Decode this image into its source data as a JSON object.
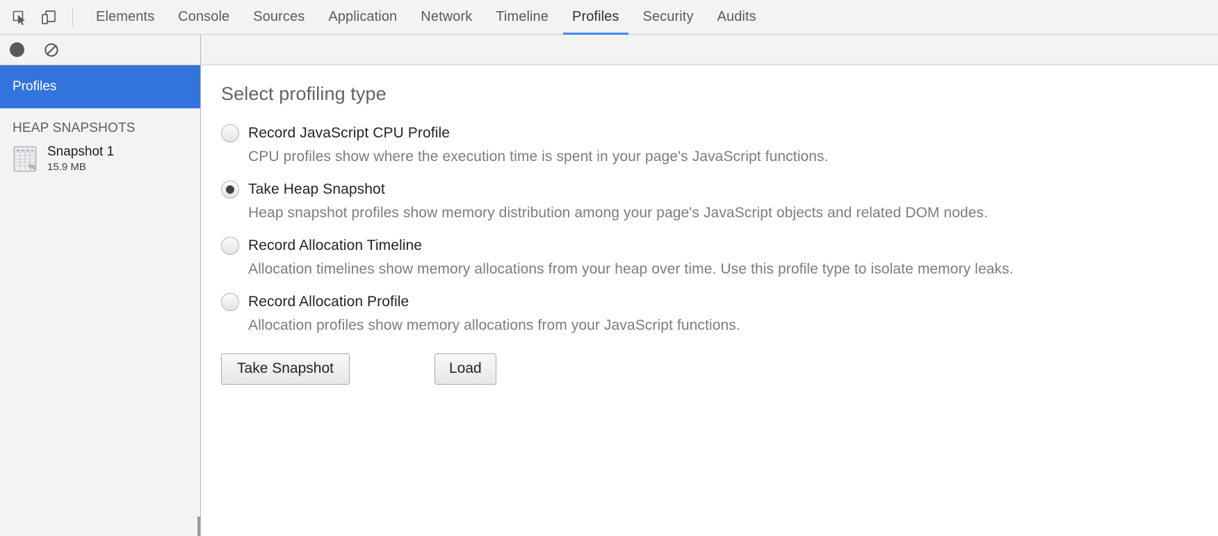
{
  "toolbar": {
    "inspect_icon": "inspect-element-icon",
    "device_icon": "device-toolbar-icon",
    "tabs": [
      {
        "label": "Elements",
        "active": false
      },
      {
        "label": "Console",
        "active": false
      },
      {
        "label": "Sources",
        "active": false
      },
      {
        "label": "Application",
        "active": false
      },
      {
        "label": "Network",
        "active": false
      },
      {
        "label": "Timeline",
        "active": false
      },
      {
        "label": "Profiles",
        "active": true
      },
      {
        "label": "Security",
        "active": false
      },
      {
        "label": "Audits",
        "active": false
      }
    ],
    "active_tab_accent": "#4285f4"
  },
  "subtoolbar": {
    "record_icon": "record-circle-icon",
    "clear_icon": "clear-prohibited-icon"
  },
  "sidebar": {
    "selected_label": "Profiles",
    "selected_bg": "#3373dc",
    "section_label": "HEAP SNAPSHOTS",
    "snapshot": {
      "icon": "heap-snapshot-grid-icon",
      "name": "Snapshot 1",
      "size": "15.9 MB"
    }
  },
  "main": {
    "title": "Select profiling type",
    "options": [
      {
        "label": "Record JavaScript CPU Profile",
        "description": "CPU profiles show where the execution time is spent in your page's JavaScript functions.",
        "checked": false
      },
      {
        "label": "Take Heap Snapshot",
        "description": "Heap snapshot profiles show memory distribution among your page's JavaScript objects and related DOM nodes.",
        "checked": true
      },
      {
        "label": "Record Allocation Timeline",
        "description": "Allocation timelines show memory allocations from your heap over time. Use this profile type to isolate memory leaks.",
        "checked": false
      },
      {
        "label": "Record Allocation Profile",
        "description": "Allocation profiles show memory allocations from your JavaScript functions.",
        "checked": false
      }
    ],
    "take_snapshot_label": "Take Snapshot",
    "load_label": "Load"
  }
}
